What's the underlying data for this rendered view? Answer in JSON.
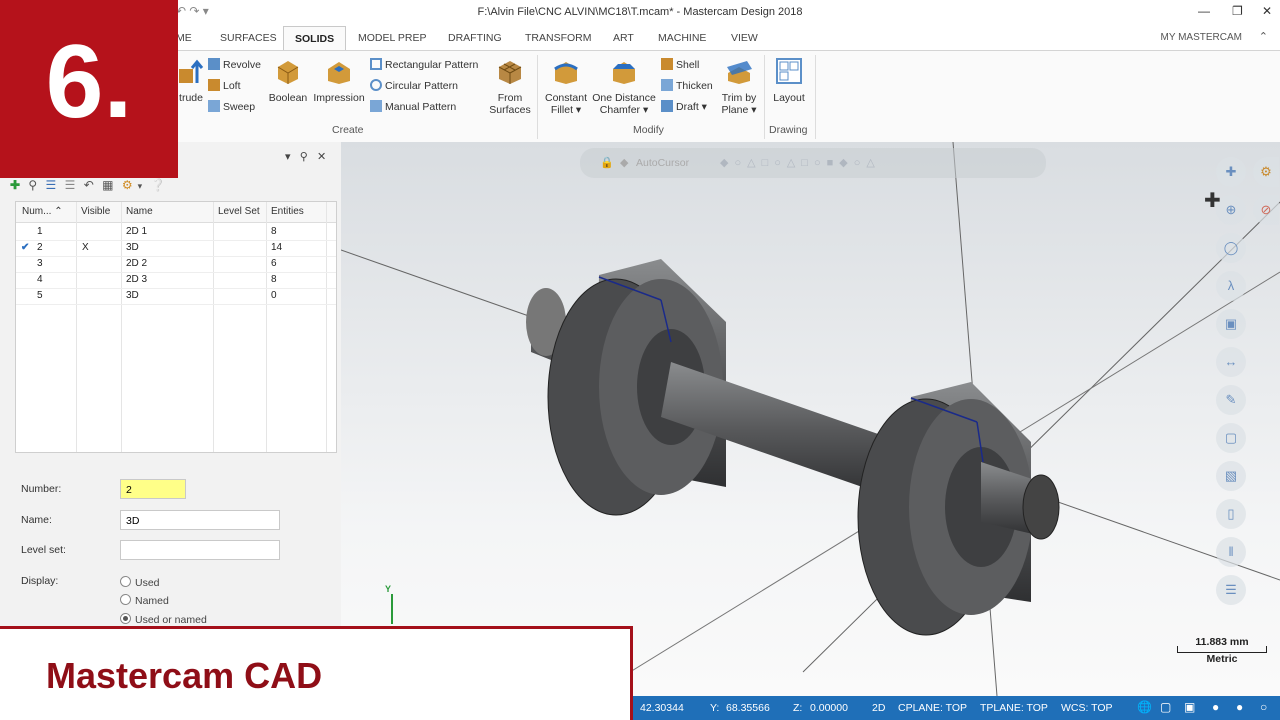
{
  "window": {
    "title": "F:\\Alvin File\\CNC ALVIN\\MC18\\T.mcam* - Mastercam Design 2018"
  },
  "tabs": [
    {
      "label": "ME",
      "active": false
    },
    {
      "label": "SURFACES",
      "active": false
    },
    {
      "label": "SOLIDS",
      "active": true
    },
    {
      "label": "MODEL PREP",
      "active": false
    },
    {
      "label": "DRAFTING",
      "active": false
    },
    {
      "label": "TRANSFORM",
      "active": false
    },
    {
      "label": "ART",
      "active": false
    },
    {
      "label": "MACHINE",
      "active": false
    },
    {
      "label": "VIEW",
      "active": false
    }
  ],
  "account": "MY MASTERCAM",
  "ribbon": {
    "create": {
      "extrude": "trude",
      "revolve": "Revolve",
      "loft": "Loft",
      "sweep": "Sweep",
      "boolean": "Boolean",
      "impression": "Impression",
      "rect_pattern": "Rectangular Pattern",
      "circ_pattern": "Circular Pattern",
      "manual_pattern": "Manual Pattern",
      "from_surfaces_1": "From",
      "from_surfaces_2": "Surfaces",
      "group": "Create"
    },
    "modify": {
      "const_fillet_1": "Constant",
      "const_fillet_2": "Fillet",
      "chamfer_1": "One Distance",
      "chamfer_2": "Chamfer",
      "shell": "Shell",
      "thicken": "Thicken",
      "draft": "Draft",
      "trim_1": "Trim by",
      "trim_2": "Plane",
      "group": "Modify"
    },
    "drawing": {
      "layout": "Layout",
      "group": "Drawing"
    }
  },
  "levels": {
    "columns": [
      "Num...",
      "Visible",
      "Name",
      "Level Set",
      "Entities"
    ],
    "rows": [
      {
        "num": "1",
        "visible": "",
        "name": "2D 1",
        "set": "",
        "entities": "8"
      },
      {
        "num": "2",
        "visible": "X",
        "name": "3D",
        "set": "",
        "entities": "14"
      },
      {
        "num": "3",
        "visible": "",
        "name": "2D 2",
        "set": "",
        "entities": "6"
      },
      {
        "num": "4",
        "visible": "",
        "name": "2D 3",
        "set": "",
        "entities": "8"
      },
      {
        "num": "5",
        "visible": "",
        "name": "3D",
        "set": "",
        "entities": "0"
      }
    ],
    "form": {
      "number_label": "Number:",
      "number_value": "2",
      "name_label": "Name:",
      "name_value": "3D",
      "levelset_label": "Level set:",
      "levelset_value": "",
      "display_label": "Display:",
      "options": [
        "Used",
        "Named",
        "Used or named"
      ],
      "selected": "Used or named"
    }
  },
  "viewport": {
    "autocursor": "AutoCursor",
    "scale_value": "11.883 mm",
    "scale_unit": "Metric",
    "axis_label": "Y"
  },
  "status": {
    "x_value": "42.30344",
    "y_label": "Y:",
    "y_value": "68.35566",
    "z_label": "Z:",
    "z_value": "0.00000",
    "mode": "2D",
    "cplane": "CPLANE: TOP",
    "tplane": "TPLANE: TOP",
    "wcs": "WCS: TOP"
  },
  "overlay": {
    "badge": "6.",
    "banner": "Mastercam CAD"
  },
  "colors": {
    "accent_red": "#b5121b",
    "status_blue": "#1f6fb8",
    "highlight_yellow": "#ffff88"
  }
}
